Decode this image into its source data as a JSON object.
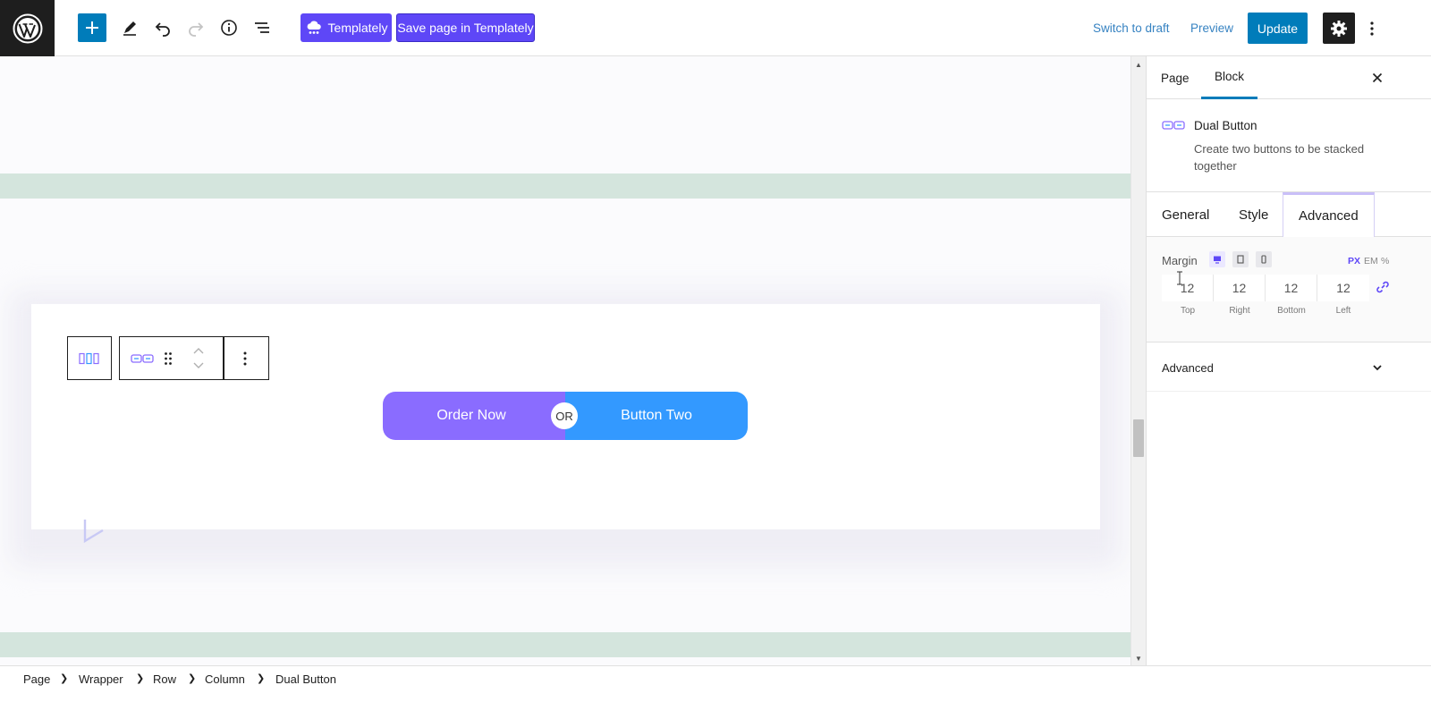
{
  "toolbar": {
    "templately_label": "Templately",
    "save_templately_label": "Save page in Templately",
    "switch_to_draft": "Switch to draft",
    "preview": "Preview",
    "update": "Update",
    "icons": [
      "wordpress-icon",
      "plus-icon",
      "pencil-icon",
      "undo-icon",
      "redo-icon",
      "info-icon",
      "list-view-icon",
      "gear-icon",
      "more-vertical-icon"
    ]
  },
  "canvas": {
    "dual_button": {
      "button_one": "Order Now",
      "separator": "OR",
      "button_two": "Button Two"
    }
  },
  "sidebar": {
    "tabs": [
      "Page",
      "Block"
    ],
    "active_tab": "Block",
    "block": {
      "name": "Dual Button",
      "description": "Create two buttons to be stacked together"
    },
    "sub_tabs": [
      "General",
      "Style",
      "Advanced"
    ],
    "active_sub_tab": "Advanced",
    "margin": {
      "label": "Margin",
      "units": [
        "PX",
        "EM",
        "%"
      ],
      "active_unit": "PX",
      "values": {
        "top": "12",
        "right": "12",
        "bottom": "12",
        "left": "12"
      },
      "captions": {
        "top": "Top",
        "right": "Right",
        "bottom": "Bottom",
        "left": "Left"
      }
    },
    "section": {
      "title": "Advanced"
    }
  },
  "breadcrumb": [
    "Page",
    "Wrapper",
    "Row",
    "Column",
    "Dual Button"
  ],
  "colors": {
    "wp_blue": "#007cba",
    "templately_purple": "#5e47f7",
    "button_one": "#8a6cff",
    "button_two": "#3399ff",
    "band": "#d4e5dd"
  }
}
